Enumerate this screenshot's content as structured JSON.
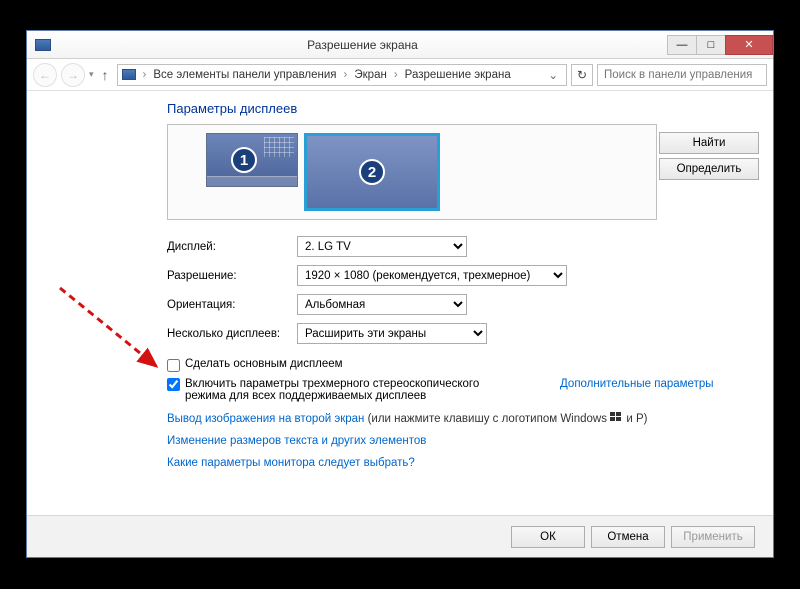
{
  "window": {
    "title": "Разрешение экрана"
  },
  "titlebar_buttons": {
    "minimize": "—",
    "maximize": "□",
    "close": "✕"
  },
  "nav": {
    "back": "←",
    "forward": "→",
    "up": "↑",
    "crumb1": "Все элементы панели управления",
    "crumb2": "Экран",
    "crumb3": "Разрешение экрана",
    "refresh": "↻",
    "search_placeholder": "Поиск в панели управления"
  },
  "heading": "Параметры дисплеев",
  "monitors": {
    "num1": "1",
    "num2": "2"
  },
  "buttons": {
    "find": "Найти",
    "identify": "Определить",
    "ok": "ОК",
    "cancel": "Отмена",
    "apply": "Применить"
  },
  "labels": {
    "display": "Дисплей:",
    "resolution": "Разрешение:",
    "orientation": "Ориентация:",
    "multiple": "Несколько дисплеев:"
  },
  "values": {
    "display": "2. LG TV",
    "resolution": "1920 × 1080 (рекомендуется, трехмерное)",
    "orientation": "Альбомная",
    "multiple": "Расширить эти экраны"
  },
  "checkboxes": {
    "make_main": "Сделать основным дисплеем",
    "stereo": "Включить параметры трехмерного стереоскопического режима для всех поддерживаемых дисплеев"
  },
  "links": {
    "advanced": "Дополнительные параметры",
    "project_pre": "Вывод изображения на второй экран",
    "project_post": " (или нажмите клавишу с логотипом Windows ",
    "project_tail": " и P)",
    "textsize": "Изменение размеров текста и других элементов",
    "whichmon": "Какие параметры монитора следует выбрать?"
  }
}
